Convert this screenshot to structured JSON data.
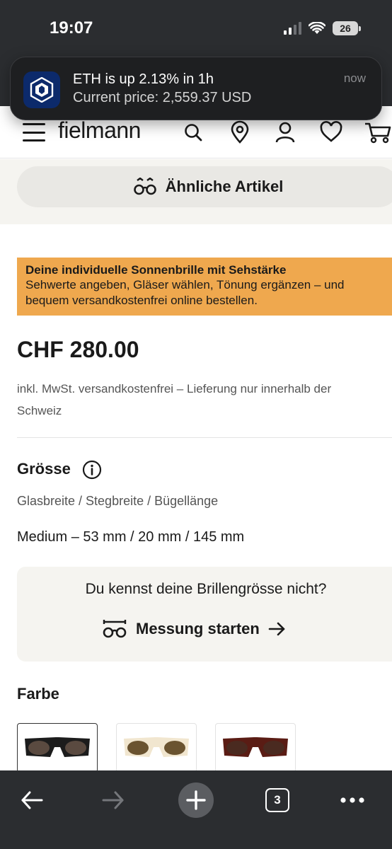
{
  "status": {
    "time": "19:07",
    "battery": "26"
  },
  "notification": {
    "title": "ETH is up 2.13% in 1h",
    "body": "Current price: 2,559.37 USD",
    "time": "now",
    "app_icon": "crypto-app-icon"
  },
  "header": {
    "logo": "fielmann",
    "icons": [
      "menu-icon",
      "search-icon",
      "location-icon",
      "account-icon",
      "heart-icon",
      "cart-icon"
    ]
  },
  "similar": {
    "label": "Ähnliche Artikel"
  },
  "promo": {
    "title": "Deine individuelle Sonnenbrille mit Sehstärke",
    "text": "Sehwerte angeben, Gläser wählen, Tönung ergänzen – und bequem versandkostenfrei online bestellen.",
    "color": "#efa84e"
  },
  "product": {
    "price": "CHF 280.00",
    "vat_note": "inkl. MwSt. versandkostenfrei – Lieferung nur innerhalb der Schweiz"
  },
  "size": {
    "title": "Grösse",
    "subtitle": "Glasbreite / Stegbreite / Bügellänge",
    "value": "Medium – 53 mm / 20 mm / 145 mm"
  },
  "measure": {
    "question": "Du kennst deine Brillengrösse nicht?",
    "button_label": "Messung starten"
  },
  "color": {
    "title": "Farbe",
    "swatches": [
      {
        "name": "black",
        "frame": "#1c1c1c",
        "lens": "#5a4a40",
        "selected": true
      },
      {
        "name": "ivory",
        "frame": "#f1e6cf",
        "lens": "#6a5330",
        "selected": false
      },
      {
        "name": "havana",
        "frame": "#5a1c14",
        "lens": "#4a2a20",
        "selected": false
      }
    ]
  },
  "browser": {
    "tab_count": "3"
  }
}
